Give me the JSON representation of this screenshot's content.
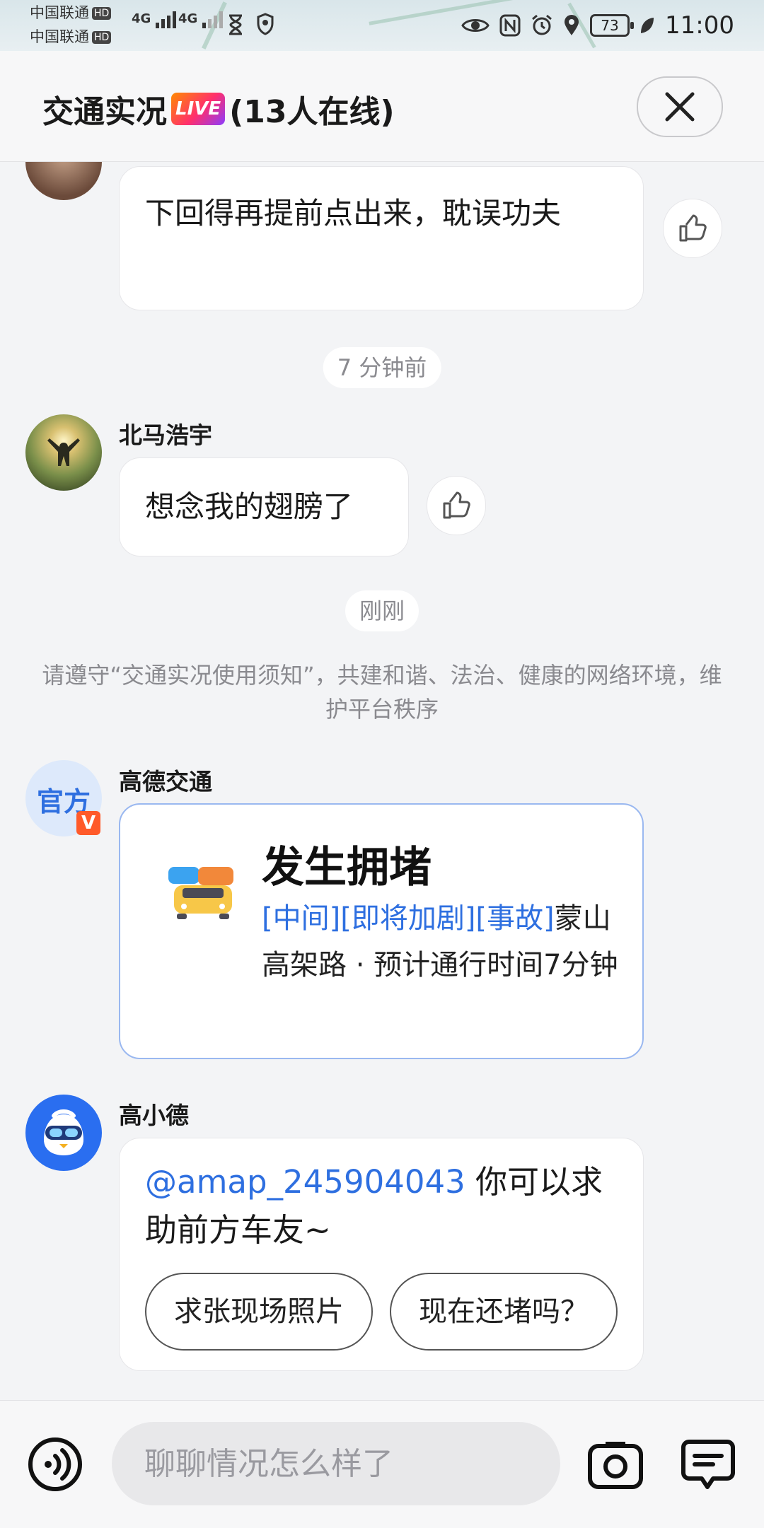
{
  "status_bar": {
    "carrier1": "中国联通",
    "carrier2": "中国联通",
    "hd_label": "HD",
    "network1": "4G",
    "network2": "4G",
    "battery": "73",
    "time": "11:00"
  },
  "header": {
    "title": "交通实况",
    "live_badge": "LIVE",
    "online": "(13人在线)"
  },
  "messages": [
    {
      "text": "下回得再提前点出来，耽误功夫"
    },
    {
      "time": "7 分钟前"
    },
    {
      "user": "北马浩宇",
      "text": "想念我的翅膀了"
    },
    {
      "time": "刚刚"
    }
  ],
  "notice": "请遵守“交通实况使用须知”，共建和谐、法治、健康的网络环境，维护平台秩序",
  "official": {
    "user": "高德交通",
    "avatar_label": "官方",
    "badge": "V",
    "card_title": "发生拥堵",
    "card_tags": "[中间][即将加剧][事故]",
    "card_text": "蒙山高架路 · 预计通行时间7分钟"
  },
  "assistant": {
    "user": "高小德",
    "mention": "@amap_245904043",
    "text": " 你可以求助前方车友~",
    "quick_replies": [
      "求张现场照片",
      "现在还堵吗？"
    ]
  },
  "input": {
    "placeholder": "聊聊情况怎么样了"
  },
  "icons": {
    "close": "close-icon",
    "like": "thumbs-up-icon",
    "voice": "voice-icon",
    "camera": "camera-icon",
    "message": "message-icon"
  }
}
